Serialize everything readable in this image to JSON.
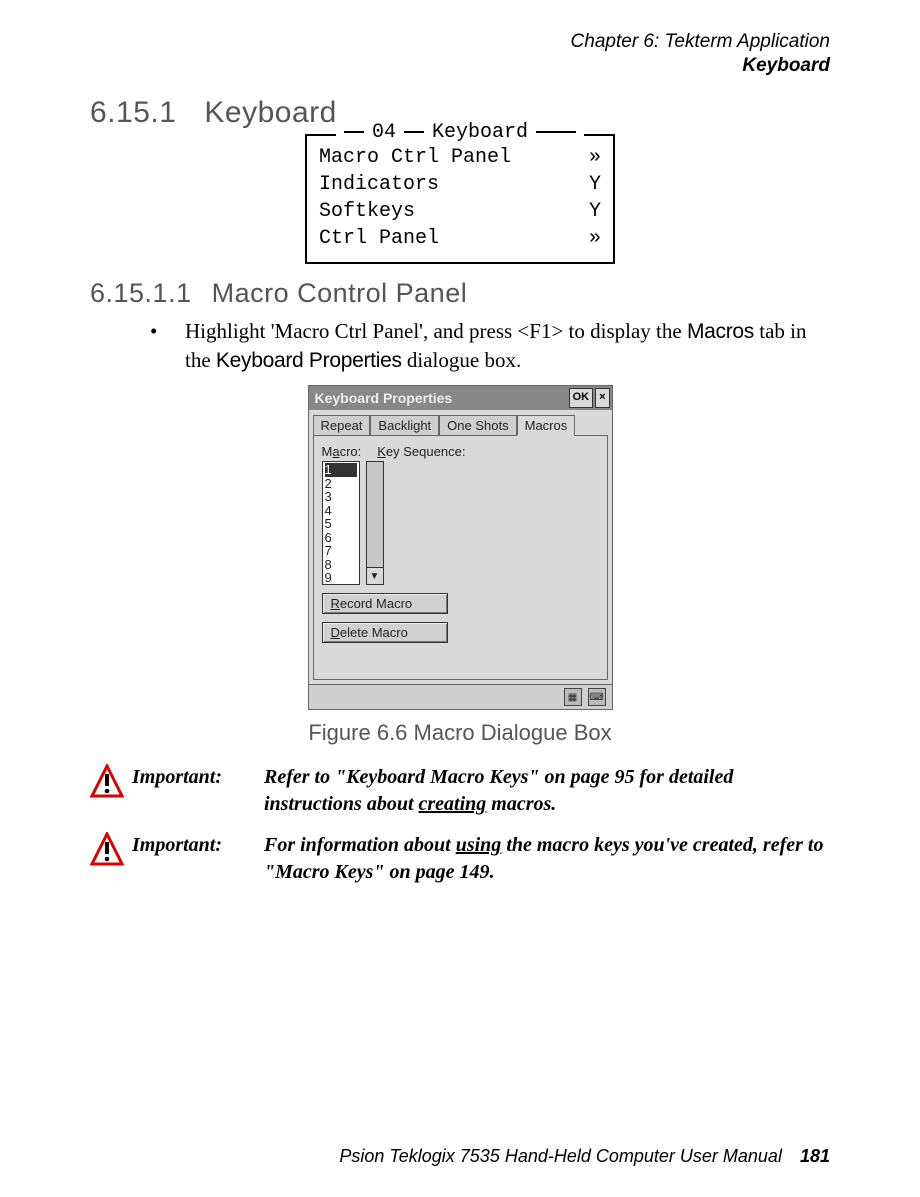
{
  "header": {
    "chapter_line": "Chapter 6: Tekterm Application",
    "section_line": "Keyboard"
  },
  "section": {
    "number_1": "6.15.1",
    "title_1": "Keyboard",
    "number_2": "6.15.1.1",
    "title_2": "Macro Control Panel"
  },
  "term_menu": {
    "legend_num": "04",
    "legend_title": "Keyboard",
    "rows": [
      {
        "label": "Macro Ctrl Panel",
        "value": "»"
      },
      {
        "label": "Indicators",
        "value": "Y"
      },
      {
        "label": "Softkeys",
        "value": "Y"
      },
      {
        "label": "Ctrl Panel",
        "value": "»"
      }
    ]
  },
  "body": {
    "bullet_pre": "Highlight 'Macro Ctrl Panel', and press <F1> to display the ",
    "bullet_em1": "Macros",
    "bullet_mid": " tab in the ",
    "bullet_em2": "Keyboard Properties",
    "bullet_post": " dialogue box."
  },
  "dialog": {
    "title": "Keyboard Properties",
    "ok": "OK",
    "close": "×",
    "tabs": [
      "Repeat",
      "Backlight",
      "One Shots",
      "Macros"
    ],
    "active_tab": 3,
    "macro_label_pre": "M",
    "macro_label_ul": "a",
    "macro_label_post": "cro:",
    "key_label_ul": "K",
    "key_label_post": "ey Sequence:",
    "list_items": [
      "1",
      "2",
      "3",
      "4",
      "5",
      "6",
      "7",
      "8",
      "9"
    ],
    "record_ul": "R",
    "record_post": "ecord Macro",
    "delete_ul": "D",
    "delete_post": "elete Macro"
  },
  "figure_caption": "Figure 6.6 Macro Dialogue Box",
  "callouts": {
    "label": "Important:",
    "c1_pre": "Refer to \"Keyboard Macro Keys\" on page 95 for detailed instructions about ",
    "c1_ul": "creating",
    "c1_post": " macros.",
    "c2_pre": "For information about ",
    "c2_ul": "using",
    "c2_post": " the macro keys you've created, refer to \"Macro Keys\" on page 149."
  },
  "footer": {
    "text": "Psion Teklogix 7535 Hand-Held Computer User Manual",
    "page": "181"
  }
}
